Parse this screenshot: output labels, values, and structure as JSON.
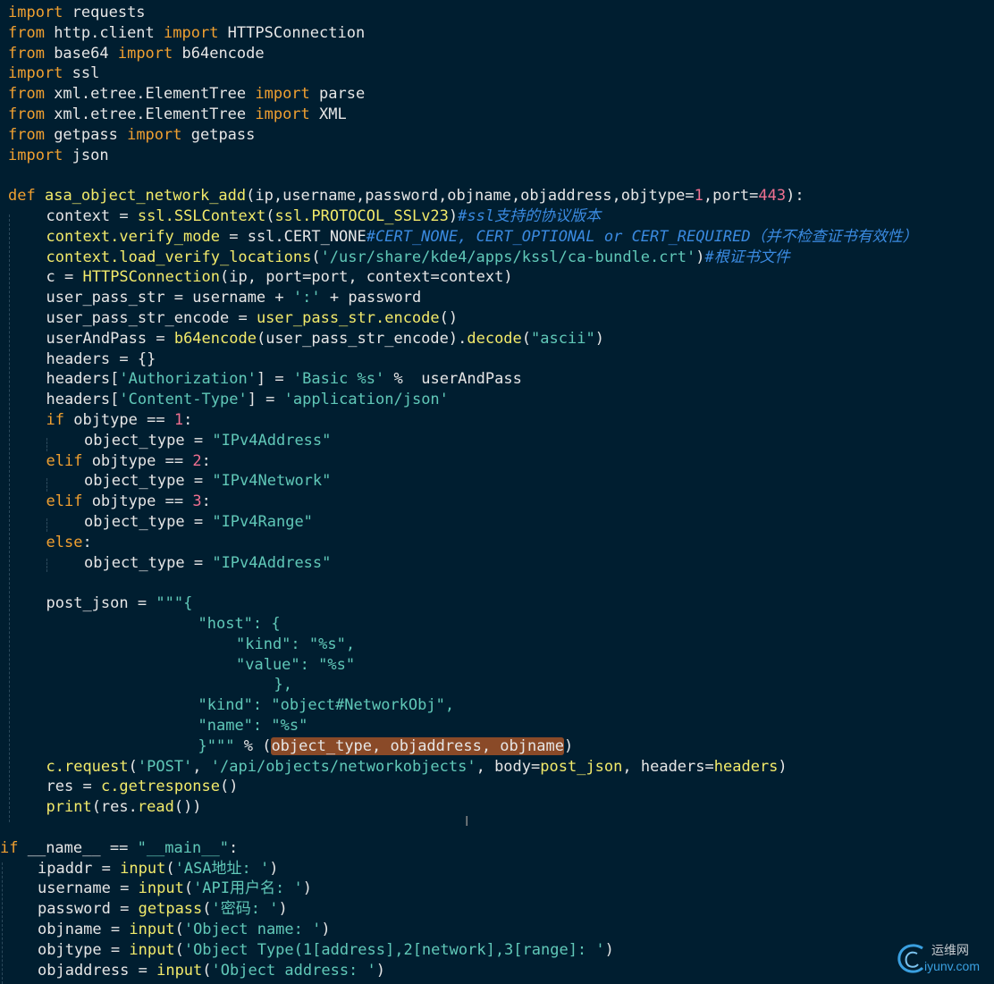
{
  "theme": {
    "background": "#001e30",
    "colors": {
      "kw": "#f0a030",
      "fn": "#f2ea6a",
      "str": "#60c8b8",
      "num": "#f07090",
      "cmt": "#3a8ae0",
      "txt": "#e6e6e6",
      "op": "#e6e6e6"
    }
  },
  "editor": {
    "lines": [
      {
        "indent": 0,
        "tokens": [
          [
            "kw",
            "import"
          ],
          [
            "txt",
            " requests"
          ]
        ]
      },
      {
        "indent": 0,
        "tokens": [
          [
            "kw",
            "from"
          ],
          [
            "txt",
            " http.client "
          ],
          [
            "kw",
            "import"
          ],
          [
            "txt",
            " HTTPSConnection"
          ]
        ]
      },
      {
        "indent": 0,
        "tokens": [
          [
            "kw",
            "from"
          ],
          [
            "txt",
            " base64 "
          ],
          [
            "kw",
            "import"
          ],
          [
            "txt",
            " b64encode"
          ]
        ]
      },
      {
        "indent": 0,
        "tokens": [
          [
            "kw",
            "import"
          ],
          [
            "txt",
            " ssl"
          ]
        ]
      },
      {
        "indent": 0,
        "tokens": [
          [
            "kw",
            "from"
          ],
          [
            "txt",
            " xml.etree.ElementTree "
          ],
          [
            "kw",
            "import"
          ],
          [
            "txt",
            " parse"
          ]
        ]
      },
      {
        "indent": 0,
        "tokens": [
          [
            "kw",
            "from"
          ],
          [
            "txt",
            " xml.etree.ElementTree "
          ],
          [
            "kw",
            "import"
          ],
          [
            "txt",
            " XML"
          ]
        ]
      },
      {
        "indent": 0,
        "tokens": [
          [
            "kw",
            "from"
          ],
          [
            "txt",
            " getpass "
          ],
          [
            "kw",
            "import"
          ],
          [
            "txt",
            " getpass"
          ]
        ]
      },
      {
        "indent": 0,
        "tokens": [
          [
            "kw",
            "import"
          ],
          [
            "txt",
            " json"
          ]
        ]
      },
      {
        "indent": 0,
        "tokens": []
      },
      {
        "indent": 0,
        "tokens": [
          [
            "kw",
            "def"
          ],
          [
            "txt",
            " "
          ],
          [
            "fn",
            "asa_object_network_add"
          ],
          [
            "txt",
            "(ip,username,password,objname,objaddress,objtype"
          ],
          [
            "op",
            "="
          ],
          [
            "num",
            "1"
          ],
          [
            "txt",
            ",port"
          ],
          [
            "op",
            "="
          ],
          [
            "num",
            "443"
          ],
          [
            "txt",
            "):"
          ]
        ]
      },
      {
        "indent": 1,
        "tokens": [
          [
            "txt",
            "context "
          ],
          [
            "op",
            "="
          ],
          [
            "txt",
            " "
          ],
          [
            "fn",
            "ssl.SSLContext"
          ],
          [
            "txt",
            "("
          ],
          [
            "fn",
            "ssl.PROTOCOL_SSLv23"
          ],
          [
            "txt",
            ")"
          ],
          [
            "cmt",
            "#ssl支持的协议版本"
          ]
        ]
      },
      {
        "indent": 1,
        "tokens": [
          [
            "fn",
            "context.verify_mode"
          ],
          [
            "txt",
            " "
          ],
          [
            "op",
            "="
          ],
          [
            "txt",
            " ssl.CERT_NONE"
          ],
          [
            "cmt",
            "#CERT_NONE, CERT_OPTIONAL or CERT_REQUIRED（并不检查证书有效性）"
          ]
        ]
      },
      {
        "indent": 1,
        "tokens": [
          [
            "fn",
            "context.load_verify_locations"
          ],
          [
            "txt",
            "("
          ],
          [
            "str",
            "'/usr/share/kde4/apps/kssl/ca-bundle.crt'"
          ],
          [
            "txt",
            ")"
          ],
          [
            "cmt",
            "#根证书文件"
          ]
        ]
      },
      {
        "indent": 1,
        "tokens": [
          [
            "txt",
            "c "
          ],
          [
            "op",
            "="
          ],
          [
            "txt",
            " "
          ],
          [
            "fn",
            "HTTPSConnection"
          ],
          [
            "txt",
            "(ip, port"
          ],
          [
            "op",
            "="
          ],
          [
            "txt",
            "port, context"
          ],
          [
            "op",
            "="
          ],
          [
            "txt",
            "context)"
          ]
        ]
      },
      {
        "indent": 1,
        "tokens": [
          [
            "txt",
            "user_pass_str "
          ],
          [
            "op",
            "="
          ],
          [
            "txt",
            " username "
          ],
          [
            "op",
            "+"
          ],
          [
            "txt",
            " "
          ],
          [
            "str",
            "':'"
          ],
          [
            "txt",
            " "
          ],
          [
            "op",
            "+"
          ],
          [
            "txt",
            " password"
          ]
        ]
      },
      {
        "indent": 1,
        "tokens": [
          [
            "txt",
            "user_pass_str_encode "
          ],
          [
            "op",
            "="
          ],
          [
            "txt",
            " "
          ],
          [
            "fn",
            "user_pass_str.encode"
          ],
          [
            "txt",
            "()"
          ]
        ]
      },
      {
        "indent": 1,
        "tokens": [
          [
            "txt",
            "userAndPass "
          ],
          [
            "op",
            "="
          ],
          [
            "txt",
            " "
          ],
          [
            "fn",
            "b64encode"
          ],
          [
            "txt",
            "(user_pass_str_encode)."
          ],
          [
            "fn",
            "decode"
          ],
          [
            "txt",
            "("
          ],
          [
            "str",
            "\"ascii\""
          ],
          [
            "txt",
            ")"
          ]
        ]
      },
      {
        "indent": 1,
        "tokens": [
          [
            "txt",
            "headers "
          ],
          [
            "op",
            "="
          ],
          [
            "txt",
            " {}"
          ]
        ]
      },
      {
        "indent": 1,
        "tokens": [
          [
            "txt",
            "headers["
          ],
          [
            "str",
            "'Authorization'"
          ],
          [
            "txt",
            "] "
          ],
          [
            "op",
            "="
          ],
          [
            "txt",
            " "
          ],
          [
            "str",
            "'Basic %s'"
          ],
          [
            "txt",
            " "
          ],
          [
            "op",
            "%"
          ],
          [
            "txt",
            "  userAndPass"
          ]
        ]
      },
      {
        "indent": 1,
        "tokens": [
          [
            "txt",
            "headers["
          ],
          [
            "str",
            "'Content-Type'"
          ],
          [
            "txt",
            "] "
          ],
          [
            "op",
            "="
          ],
          [
            "txt",
            " "
          ],
          [
            "str",
            "'application/json'"
          ]
        ]
      },
      {
        "indent": 1,
        "tokens": [
          [
            "kw",
            "if"
          ],
          [
            "txt",
            " objtype "
          ],
          [
            "op",
            "=="
          ],
          [
            "txt",
            " "
          ],
          [
            "num",
            "1"
          ],
          [
            "txt",
            ":"
          ]
        ]
      },
      {
        "indent": 2,
        "tokens": [
          [
            "txt",
            "object_type "
          ],
          [
            "op",
            "="
          ],
          [
            "txt",
            " "
          ],
          [
            "str",
            "\"IPv4Address\""
          ]
        ]
      },
      {
        "indent": 1,
        "tokens": [
          [
            "kw",
            "elif"
          ],
          [
            "txt",
            " objtype "
          ],
          [
            "op",
            "=="
          ],
          [
            "txt",
            " "
          ],
          [
            "num",
            "2"
          ],
          [
            "txt",
            ":"
          ]
        ]
      },
      {
        "indent": 2,
        "tokens": [
          [
            "txt",
            "object_type "
          ],
          [
            "op",
            "="
          ],
          [
            "txt",
            " "
          ],
          [
            "str",
            "\"IPv4Network\""
          ]
        ]
      },
      {
        "indent": 1,
        "tokens": [
          [
            "kw",
            "elif"
          ],
          [
            "txt",
            " objtype "
          ],
          [
            "op",
            "=="
          ],
          [
            "txt",
            " "
          ],
          [
            "num",
            "3"
          ],
          [
            "txt",
            ":"
          ]
        ]
      },
      {
        "indent": 2,
        "tokens": [
          [
            "txt",
            "object_type "
          ],
          [
            "op",
            "="
          ],
          [
            "txt",
            " "
          ],
          [
            "str",
            "\"IPv4Range\""
          ]
        ]
      },
      {
        "indent": 1,
        "tokens": [
          [
            "kw",
            "else"
          ],
          [
            "txt",
            ":"
          ]
        ]
      },
      {
        "indent": 2,
        "tokens": [
          [
            "txt",
            "object_type "
          ],
          [
            "op",
            "="
          ],
          [
            "txt",
            " "
          ],
          [
            "str",
            "\"IPv4Address\""
          ]
        ]
      },
      {
        "indent": 0,
        "tokens": []
      },
      {
        "indent": 1,
        "tokens": [
          [
            "txt",
            "post_json "
          ],
          [
            "op",
            "="
          ],
          [
            "txt",
            " "
          ],
          [
            "str",
            "\"\"\"{"
          ]
        ]
      },
      {
        "indent": 5,
        "tokens": [
          [
            "str",
            "\"host\": {"
          ]
        ]
      },
      {
        "indent": 6,
        "tokens": [
          [
            "str",
            "\"kind\": \"%s\","
          ]
        ]
      },
      {
        "indent": 6,
        "tokens": [
          [
            "str",
            "\"value\": \"%s\""
          ]
        ]
      },
      {
        "indent": 7,
        "tokens": [
          [
            "str",
            "},"
          ]
        ]
      },
      {
        "indent": 5,
        "tokens": [
          [
            "str",
            "\"kind\": \"object#NetworkObj\","
          ]
        ]
      },
      {
        "indent": 5,
        "tokens": [
          [
            "str",
            "\"name\": \"%s\""
          ]
        ]
      },
      {
        "indent": 5,
        "tokens": [
          [
            "str",
            "}\"\"\""
          ],
          [
            "txt",
            " "
          ],
          [
            "op",
            "%"
          ],
          [
            "txt",
            " ("
          ],
          [
            "hl",
            "object_type, objaddress, objname"
          ],
          [
            "txt",
            ")"
          ]
        ]
      },
      {
        "indent": 1,
        "tokens": [
          [
            "fn",
            "c.request"
          ],
          [
            "txt",
            "("
          ],
          [
            "str",
            "'POST'"
          ],
          [
            "txt",
            ", "
          ],
          [
            "str",
            "'/api/objects/networkobjects'"
          ],
          [
            "txt",
            ", body"
          ],
          [
            "op",
            "="
          ],
          [
            "fn",
            "post_json"
          ],
          [
            "txt",
            ", headers"
          ],
          [
            "op",
            "="
          ],
          [
            "fn",
            "headers"
          ],
          [
            "txt",
            ")"
          ]
        ]
      },
      {
        "indent": 1,
        "tokens": [
          [
            "txt",
            "res "
          ],
          [
            "op",
            "="
          ],
          [
            "txt",
            " "
          ],
          [
            "fn",
            "c.getresponse"
          ],
          [
            "txt",
            "()"
          ]
        ]
      },
      {
        "indent": 1,
        "tokens": [
          [
            "fn",
            "print"
          ],
          [
            "txt",
            "(res."
          ],
          [
            "fn",
            "read"
          ],
          [
            "txt",
            "())"
          ]
        ]
      },
      {
        "indent": 0,
        "tokens": []
      },
      {
        "indent": 0,
        "tokens": [
          [
            "kw",
            "if"
          ],
          [
            "txt",
            " __name__ "
          ],
          [
            "op",
            "=="
          ],
          [
            "txt",
            " "
          ],
          [
            "str",
            "\"__main__\""
          ],
          [
            "txt",
            ":"
          ]
        ]
      },
      {
        "indent": 1,
        "tokens": [
          [
            "txt",
            "ipaddr "
          ],
          [
            "op",
            "="
          ],
          [
            "txt",
            " "
          ],
          [
            "fn",
            "input"
          ],
          [
            "txt",
            "("
          ],
          [
            "str",
            "'ASA地址: '"
          ],
          [
            "txt",
            ")"
          ]
        ]
      },
      {
        "indent": 1,
        "tokens": [
          [
            "txt",
            "username "
          ],
          [
            "op",
            "="
          ],
          [
            "txt",
            " "
          ],
          [
            "fn",
            "input"
          ],
          [
            "txt",
            "("
          ],
          [
            "str",
            "'API用户名: '"
          ],
          [
            "txt",
            ")"
          ]
        ]
      },
      {
        "indent": 1,
        "tokens": [
          [
            "txt",
            "password "
          ],
          [
            "op",
            "="
          ],
          [
            "txt",
            " "
          ],
          [
            "fn",
            "getpass"
          ],
          [
            "txt",
            "("
          ],
          [
            "str",
            "'密码: '"
          ],
          [
            "txt",
            ")"
          ]
        ]
      },
      {
        "indent": 1,
        "tokens": [
          [
            "txt",
            "objname "
          ],
          [
            "op",
            "="
          ],
          [
            "txt",
            " "
          ],
          [
            "fn",
            "input"
          ],
          [
            "txt",
            "("
          ],
          [
            "str",
            "'Object name: '"
          ],
          [
            "txt",
            ")"
          ]
        ]
      },
      {
        "indent": 1,
        "tokens": [
          [
            "txt",
            "objtype "
          ],
          [
            "op",
            "="
          ],
          [
            "txt",
            " "
          ],
          [
            "fn",
            "input"
          ],
          [
            "txt",
            "("
          ],
          [
            "str",
            "'Object Type(1[address],2[network],3[range]: '"
          ],
          [
            "txt",
            ")"
          ]
        ]
      },
      {
        "indent": 1,
        "tokens": [
          [
            "txt",
            "objaddress "
          ],
          [
            "op",
            "="
          ],
          [
            "txt",
            " "
          ],
          [
            "fn",
            "input"
          ],
          [
            "txt",
            "("
          ],
          [
            "str",
            "'Object address: '"
          ],
          [
            "txt",
            ")"
          ]
        ]
      }
    ]
  },
  "watermark": {
    "cn": "运维网",
    "en": "iyunv.com",
    "icon": "swirl-logo-icon"
  }
}
